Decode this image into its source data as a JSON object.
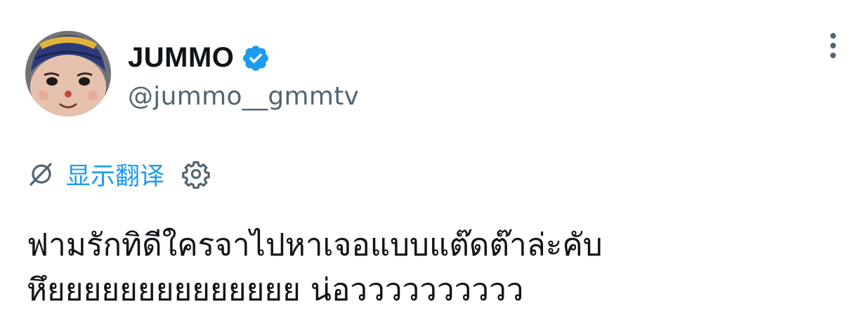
{
  "tweet": {
    "author": {
      "display_name": "JUMMO",
      "handle": "@jummo__gmmtv",
      "verified": true,
      "avatar_icon": "mascot-avatar"
    },
    "more_icon": "more-vertical-icon",
    "translate": {
      "icon": "translate-slash-icon",
      "label": "显示翻译",
      "settings_icon": "gear-icon"
    },
    "text_lines": [
      "ฟามรักทิดีใครจาไปหาเจอแบบแต๊ดต๊าล่ะคับ",
      "หึยยยยยยยยยยยยยย น่อวววววววววว"
    ]
  },
  "colors": {
    "accent": "#1d9bf0",
    "secondary_text": "#536471",
    "primary_text": "#0f1419",
    "verified_badge": "#1d9bf0"
  }
}
